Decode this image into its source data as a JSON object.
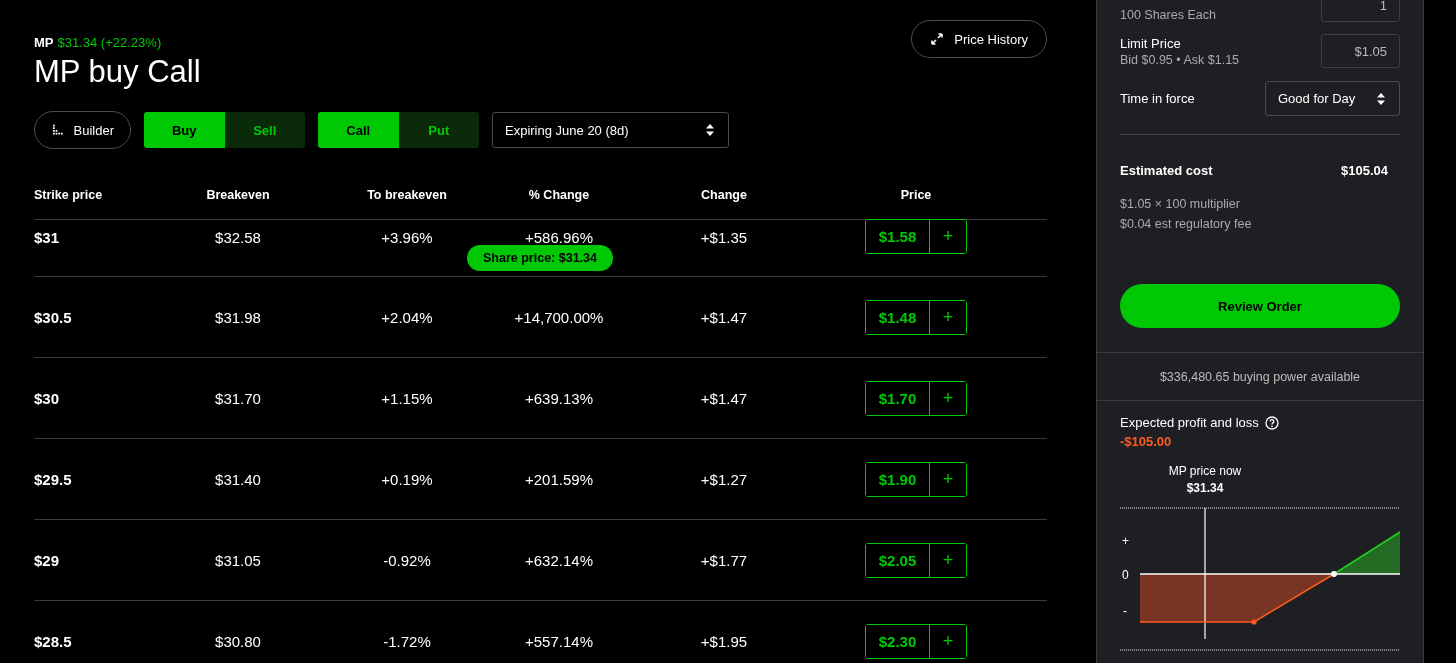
{
  "header": {
    "symbol": "MP",
    "quote": "$31.34 (+22.23%)",
    "title": "MP buy Call",
    "price_history": "Price History"
  },
  "toolbar": {
    "builder": "Builder",
    "side": [
      {
        "label": "Buy",
        "selected": true
      },
      {
        "label": "Sell",
        "selected": false
      }
    ],
    "option_type": [
      {
        "label": "Call",
        "selected": true
      },
      {
        "label": "Put",
        "selected": false
      }
    ],
    "expiration": "Expiring June 20 (8d)"
  },
  "table": {
    "columns": [
      "Strike price",
      "Breakeven",
      "To breakeven",
      "% Change",
      "Change",
      "Price"
    ],
    "rows": [
      {
        "strike": "$31",
        "breakeven": "$32.58",
        "to_breakeven": "+3.96%",
        "pct_change": "+586.96%",
        "change": "+$1.35",
        "price": "$1.58",
        "add": "+"
      },
      {
        "strike": "$30.5",
        "breakeven": "$31.98",
        "to_breakeven": "+2.04%",
        "pct_change": "+14,700.00%",
        "change": "+$1.47",
        "price": "$1.48",
        "add": "+"
      },
      {
        "strike": "$30",
        "breakeven": "$31.70",
        "to_breakeven": "+1.15%",
        "pct_change": "+639.13%",
        "change": "+$1.47",
        "price": "$1.70",
        "add": "+"
      },
      {
        "strike": "$29.5",
        "breakeven": "$31.40",
        "to_breakeven": "+0.19%",
        "pct_change": "+201.59%",
        "change": "+$1.27",
        "price": "$1.90",
        "add": "+"
      },
      {
        "strike": "$29",
        "breakeven": "$31.05",
        "to_breakeven": "-0.92%",
        "pct_change": "+632.14%",
        "change": "+$1.77",
        "price": "$2.05",
        "add": "+"
      },
      {
        "strike": "$28.5",
        "breakeven": "$30.80",
        "to_breakeven": "-1.72%",
        "pct_change": "+557.14%",
        "change": "+$1.95",
        "price": "$2.30",
        "add": "+"
      }
    ],
    "share_price_tag": "Share price: $31.34"
  },
  "order_panel": {
    "contracts_note": "100 Shares Each",
    "contracts_value": "1",
    "limit_label": "Limit Price",
    "limit_note": "Bid $0.95 • Ask $1.15",
    "limit_value": "$1.05",
    "tif_label": "Time in force",
    "tif_value": "Good for Day",
    "cost_label": "Estimated cost",
    "cost_value": "$105.04",
    "cost_lines": [
      "$1.05 × 100 multiplier",
      "$0.04 est regulatory fee"
    ],
    "review_button": "Review Order",
    "buying_power": "$336,480.65 buying power available",
    "pnl_title": "Expected profit and loss",
    "pnl_value": "-$105.00",
    "price_now_label": "MP price now",
    "price_now_value": "$31.34",
    "axis_labels": [
      "+",
      "0",
      "-"
    ]
  }
}
